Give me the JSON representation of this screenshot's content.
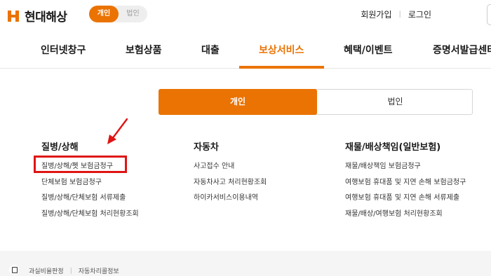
{
  "brand": {
    "name": "현대해상",
    "color": "#ea7303"
  },
  "customer_toggle": {
    "personal": "개인",
    "corporate": "법인"
  },
  "utility": {
    "join": "회원가입",
    "login": "로그인"
  },
  "gnb": {
    "items": [
      {
        "label": "인터넷창구"
      },
      {
        "label": "보험상품"
      },
      {
        "label": "대출"
      },
      {
        "label": "보상서비스",
        "active": true
      },
      {
        "label": "혜택/이벤트"
      },
      {
        "label": "증명서발급센터"
      }
    ]
  },
  "tabs": {
    "personal": "개인",
    "corporate": "법인"
  },
  "columns": [
    {
      "title": "질병/상해",
      "links": [
        "질병/상해/펫 보험금청구",
        "단체보험 보험금청구",
        "질병/상해/단체보험 서류제출",
        "질병/상해/단체보험 처리현황조회"
      ]
    },
    {
      "title": "자동차",
      "links": [
        "사고접수 안내",
        "자동차사고 처리현황조회",
        "하이카서비스이용내역"
      ]
    },
    {
      "title": "재물/배상책임(일반보험)",
      "links": [
        "재물/배상책임 보험금청구",
        "여행보험 휴대품 및 지연 손해 보험금청구",
        "여행보험 휴대품 및 지연 손해 서류제출",
        "재물/배상/여행보험 처리현황조회"
      ]
    }
  ],
  "footer": {
    "links": [
      "과실비율판정",
      "자동차리콜정보"
    ]
  },
  "colors": {
    "accent": "#ea7303",
    "highlight": "#e01414"
  }
}
